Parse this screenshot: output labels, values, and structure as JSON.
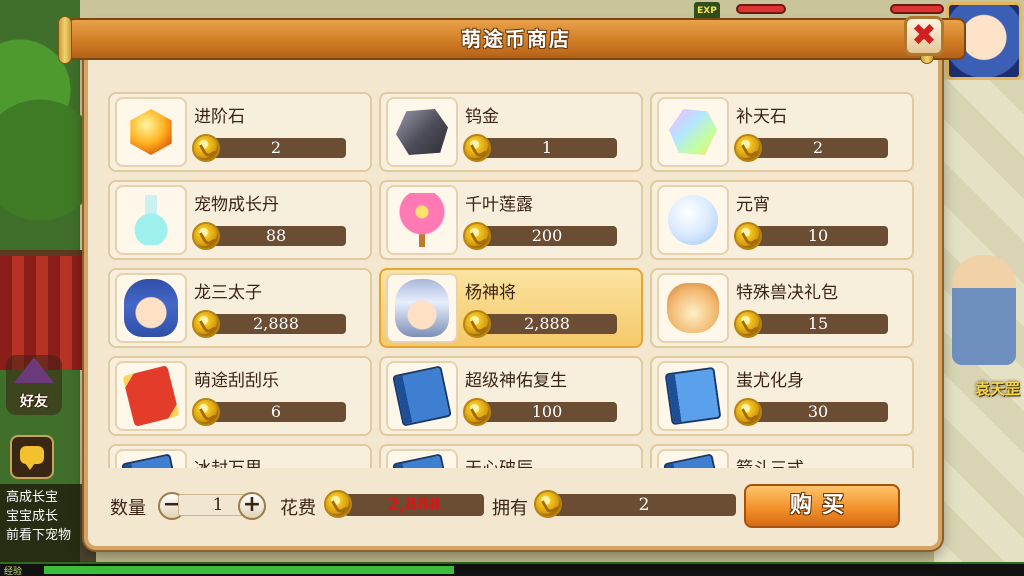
{
  "shop": {
    "title": "萌途币商店",
    "close_symbol": "✖",
    "items": [
      {
        "name": "进阶石",
        "price": "2",
        "icon": "orange-gem-icon"
      },
      {
        "name": "钨金",
        "price": "1",
        "icon": "tungsten-rock-icon"
      },
      {
        "name": "补天石",
        "price": "2",
        "icon": "rainbow-crystal-icon"
      },
      {
        "name": "宠物成长丹",
        "price": "88",
        "icon": "pet-growth-pill-bottle-icon"
      },
      {
        "name": "千叶莲露",
        "price": "200",
        "icon": "lotus-dew-orb-icon"
      },
      {
        "name": "元宵",
        "price": "10",
        "icon": "rice-ball-icon"
      },
      {
        "name": "龙三太子",
        "price": "2,888",
        "icon": "dragon-prince-portrait-icon"
      },
      {
        "name": "杨神将",
        "price": "2,888",
        "icon": "general-yang-portrait-icon",
        "selected": true
      },
      {
        "name": "特殊兽决礼包",
        "price": "15",
        "icon": "gift-bag-icon"
      },
      {
        "name": "萌途刮刮乐",
        "price": "6",
        "icon": "scratch-ticket-icon"
      },
      {
        "name": "超级神佑复生",
        "price": "100",
        "icon": "blue-skill-book-icon"
      },
      {
        "name": "蚩尤化身",
        "price": "30",
        "icon": "blue-skill-book-icon"
      },
      {
        "name": "冰封万里",
        "price": "",
        "icon": "blue-skill-book-icon"
      },
      {
        "name": "天心破辰",
        "price": "",
        "icon": "blue-skill-book-icon"
      },
      {
        "name": "箭斗三式",
        "price": "",
        "icon": "blue-skill-book-icon"
      }
    ],
    "footer": {
      "quantity_label": "数量",
      "quantity_value": "1",
      "minus_symbol": "−",
      "plus_symbol": "+",
      "cost_label": "花费",
      "cost_value": "2,888",
      "own_label": "拥有",
      "own_value": "2",
      "buy_label": "购买"
    }
  },
  "hud": {
    "exp_tag": "EXP",
    "friends_label": "好友",
    "npc_name": "袁天罡",
    "chat_lines": [
      "高成长宝",
      "宝宝成长",
      "前看下宠物"
    ],
    "xp_label": "经验"
  },
  "colors": {
    "title_bar": "#cf7a22",
    "panel": "#f3e7cf",
    "price_bar": "#6b4d33",
    "selected_card": "#f5c96a",
    "cost_text": "#e01414",
    "buy_button": "#f3922c"
  }
}
